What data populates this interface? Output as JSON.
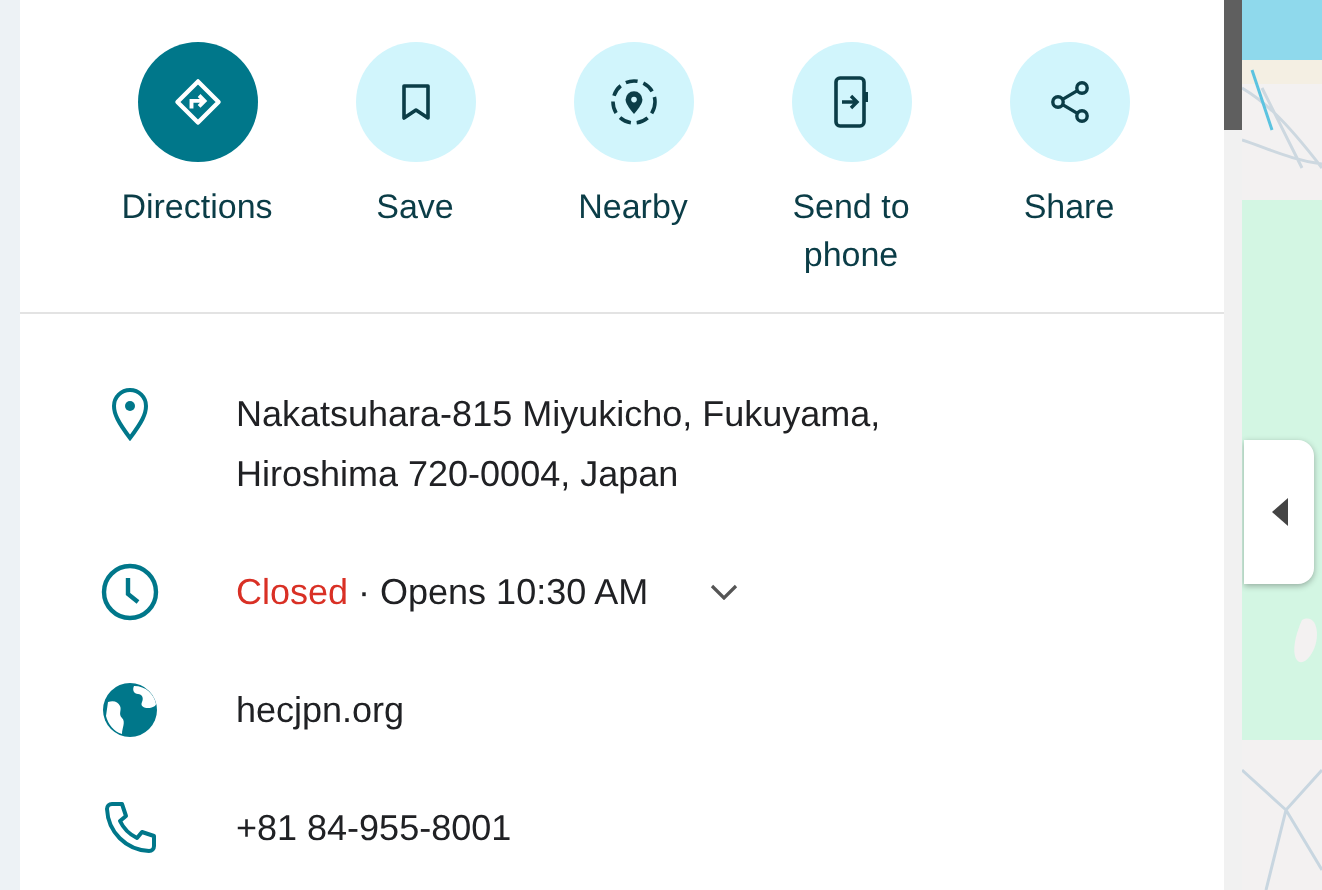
{
  "actions": [
    {
      "label": "Directions",
      "kind": "primary"
    },
    {
      "label": "Save",
      "kind": "secondary"
    },
    {
      "label": "Nearby",
      "kind": "secondary"
    },
    {
      "label": "Send to phone",
      "kind": "secondary"
    },
    {
      "label": "Share",
      "kind": "secondary"
    }
  ],
  "details": [
    {
      "kind": "address",
      "lines": [
        "Nakatsuhara-815 Miyukicho, Fukuyama,",
        "Hiroshima 720-0004, Japan"
      ]
    },
    {
      "kind": "hours",
      "status": "Closed",
      "text": "· Opens 10:30 AM",
      "expanded": false
    },
    {
      "kind": "website",
      "text": "hecjpn.org"
    },
    {
      "kind": "phone",
      "text": "+81 84-955-8001"
    }
  ],
  "map": {
    "kind": "picture",
    "collapse_tab": {
      "expanded": true
    }
  }
}
